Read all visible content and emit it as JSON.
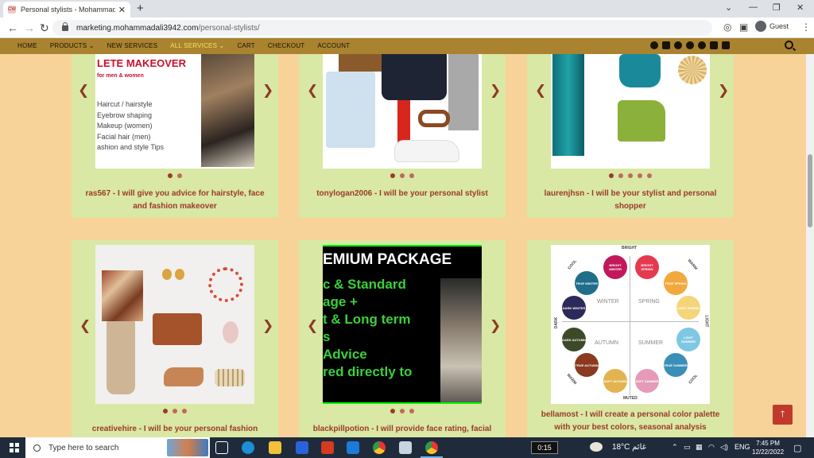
{
  "browser": {
    "tab_title": "Personal stylists - Mohammad M",
    "url_host": "marketing.mohammadali3942.com",
    "url_path": "/personal-stylists/",
    "guest_label": "Guest"
  },
  "nav": {
    "items": [
      {
        "label": "HOME"
      },
      {
        "label": "PRODUCTS ⌄"
      },
      {
        "label": "NEW SERVICES"
      },
      {
        "label": "ALL SERVICES ⌄"
      },
      {
        "label": "CART"
      },
      {
        "label": "CHECKOUT"
      },
      {
        "label": "ACCOUNT"
      }
    ],
    "active_index": 3,
    "social_icons": [
      "facebook-icon",
      "instagram-icon",
      "whatsapp-icon",
      "telegram-icon",
      "twitter-icon",
      "email-icon",
      "linkedin-icon"
    ]
  },
  "cards": [
    {
      "caption": "ras567 - I will give you advice for hairstyle, face and fashion makeover",
      "dots": 2,
      "active_dot": 0,
      "image": {
        "title": "LETE MAKEOVER",
        "subtitle": "for men & women",
        "list": [
          "Haircut / hairstyle",
          "Eyebrow shaping",
          "Makeup (women)",
          "Facial hair (men)",
          "ashion and style Tips"
        ]
      }
    },
    {
      "caption": "tonylogan2006 - I will be your personal stylist",
      "dots": 3,
      "active_dot": 0
    },
    {
      "caption": "laurenjhsn - I will be your stylist and personal shopper",
      "dots": 5,
      "active_dot": 0
    },
    {
      "caption": "creativehire - I will be your personal fashion",
      "dots": 3,
      "active_dot": 0
    },
    {
      "caption": "blackpillpotion - I will provide face rating, facial",
      "dots": 3,
      "active_dot": 0,
      "image": {
        "title": "EMIUM PACKAGE",
        "lines": [
          "c & Standard",
          "age +",
          "t & Long term",
          "s",
          " Advice",
          "red directly to"
        ]
      }
    },
    {
      "caption": "bellamost - I will create a personal color palette with your best colors, seasonal analysis",
      "dots": 0,
      "active_dot": 0,
      "image": {
        "edge_top": "BRIGHT",
        "edge_bottom": "MUTED",
        "edge_left": "DARK",
        "edge_right": "LIGHT",
        "warm_top": "WARM",
        "cool_top": "COOL",
        "warm_bottom": "WARM",
        "cool_bottom": "COOL",
        "quadrants": [
          "WINTER",
          "SPRING",
          "AUTUMN",
          "SUMMER"
        ],
        "swatches": [
          {
            "label": "BRIGHT WINTER",
            "color": "#c2185b"
          },
          {
            "label": "BRIGHT SPRING",
            "color": "#e53950"
          },
          {
            "label": "TRUE WINTER",
            "color": "#1f6f8b"
          },
          {
            "label": "TRUE SPRING",
            "color": "#f2a93b"
          },
          {
            "label": "DARK WINTER",
            "color": "#2c2a5a"
          },
          {
            "label": "LIGHT SPRING",
            "color": "#f4d57a"
          },
          {
            "label": "DARK AUTUMN",
            "color": "#3d4a2a"
          },
          {
            "label": "LIGHT SUMMER",
            "color": "#7ec8e3"
          },
          {
            "label": "TRUE AUTUMN",
            "color": "#8b3a1f"
          },
          {
            "label": "TRUE SUMMER",
            "color": "#3a8fb7"
          },
          {
            "label": "SOFT AUTUMN",
            "color": "#e2b34f"
          },
          {
            "label": "SOFT SUMMER",
            "color": "#e59ab7"
          }
        ]
      }
    }
  ],
  "taskbar": {
    "search_placeholder": "Type here to search",
    "timer": "0:15",
    "weather": "18°C  غائم",
    "lang": "ENG",
    "time": "7:45 PM",
    "date": "12/22/2022"
  }
}
